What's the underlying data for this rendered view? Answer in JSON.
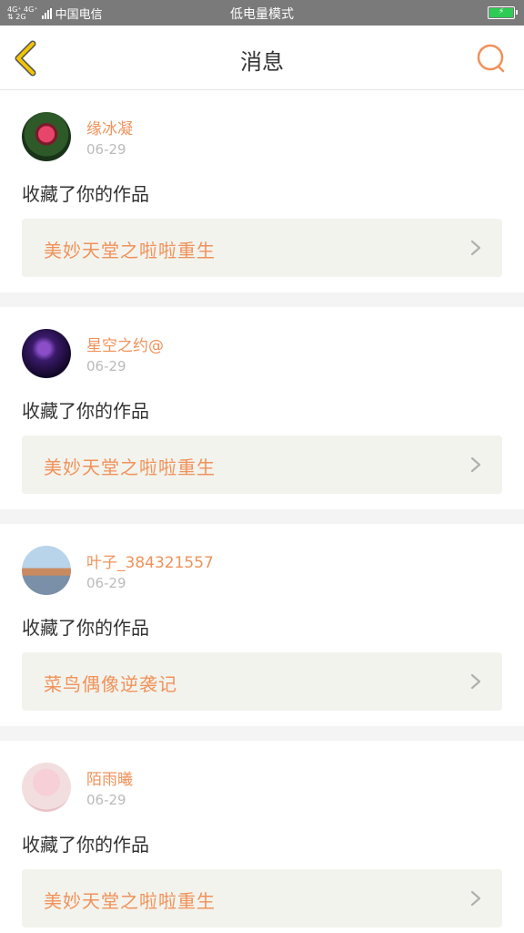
{
  "status_bar": {
    "network_top": "4G⁺ 4G⁺",
    "network_bottom": "⇅ 2G",
    "carrier": "中国电信",
    "mode": "低电量模式",
    "battery_icon": "battery-charging-icon"
  },
  "header": {
    "title": "消息",
    "back_icon": "back-chevron-icon",
    "search_icon": "search-icon",
    "accent_color": "#f0925a",
    "back_color": "#f2c400"
  },
  "messages": [
    {
      "username": "缘冰凝",
      "date": "06-29",
      "action": "收藏了你的作品",
      "work_title": "美妙天堂之啦啦重生"
    },
    {
      "username": "星空之约@",
      "date": "06-29",
      "action": "收藏了你的作品",
      "work_title": "美妙天堂之啦啦重生"
    },
    {
      "username": "叶子_384321557",
      "date": "06-29",
      "action": "收藏了你的作品",
      "work_title": "菜鸟偶像逆袭记"
    },
    {
      "username": "陌雨曦",
      "date": "06-29",
      "action": "收藏了你的作品",
      "work_title": "美妙天堂之啦啦重生"
    }
  ]
}
